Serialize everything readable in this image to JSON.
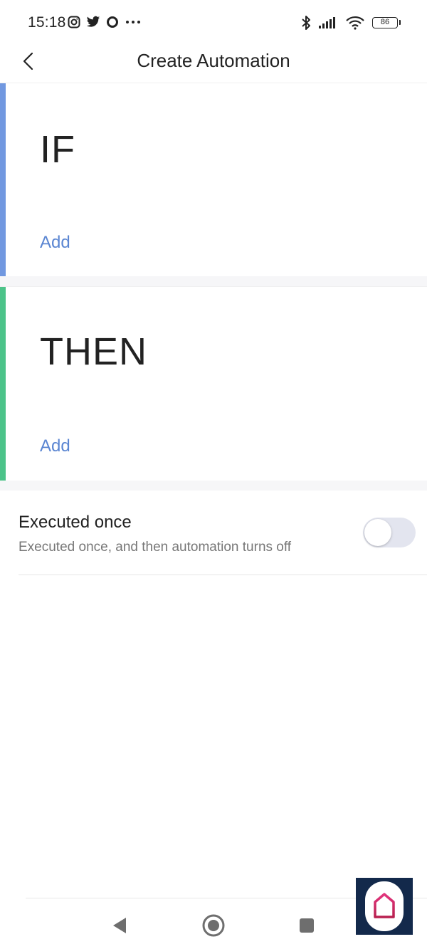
{
  "status_bar": {
    "time": "15:18",
    "battery": "86",
    "left_icons": [
      "instagram-icon",
      "twitter-icon",
      "circle-app-icon",
      "more-icon"
    ],
    "right_icons": [
      "bluetooth-icon",
      "signal-icon",
      "wifi-icon",
      "battery-icon"
    ]
  },
  "header": {
    "title": "Create Automation",
    "back_icon": "chevron-left-icon"
  },
  "if_section": {
    "title": "IF",
    "add_label": "Add",
    "accent_color": "#7198e0"
  },
  "then_section": {
    "title": "THEN",
    "add_label": "Add",
    "accent_color": "#4cc389"
  },
  "executed_once": {
    "title": "Executed once",
    "description": "Executed once, and then automation turns off",
    "enabled": false
  },
  "nav_bar": {
    "buttons": [
      "back-triangle-icon",
      "home-circle-icon",
      "recents-square-icon"
    ]
  },
  "floating_app": {
    "icon": "home-app-icon",
    "color": "#13294b"
  }
}
